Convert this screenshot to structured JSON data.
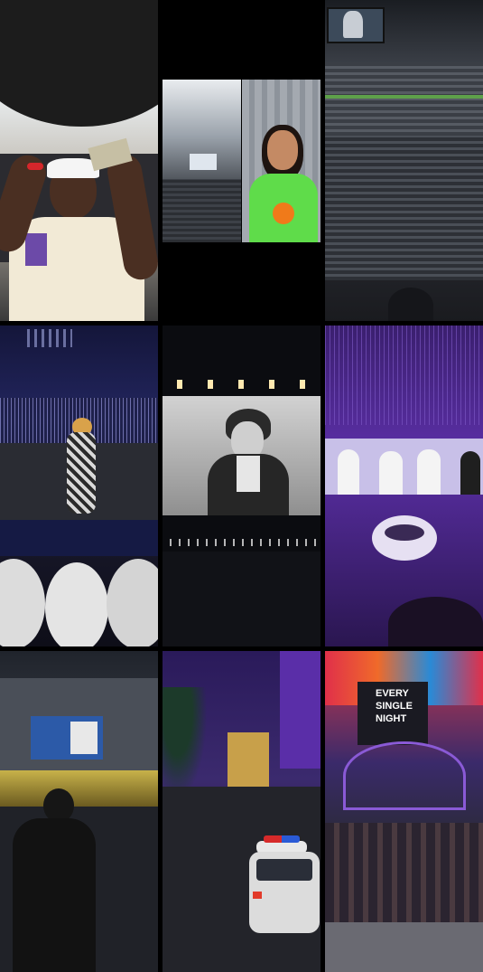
{
  "page": {
    "background": "#000000"
  },
  "tiles": [
    {
      "scene": "selfie-man-with-cash",
      "accent": "#f2ead6"
    },
    {
      "scene": "split-stadium-and-woman",
      "accent": "#5fdc4a"
    },
    {
      "scene": "stadium-crowd",
      "accent": "#3a3f4a"
    },
    {
      "scene": "concert-stage-performer",
      "accent": "#2a2350"
    },
    {
      "scene": "concert-screen-closeup",
      "accent": "#cfcfcf"
    },
    {
      "scene": "purple-concert-screen",
      "accent": "#7b3fc4"
    },
    {
      "scene": "arena-exterior-night",
      "accent": "#2f3440"
    },
    {
      "scene": "las-vegas-street-police",
      "accent": "#3b2a6e"
    },
    {
      "scene": "fremont-street-canopy",
      "accent": "#c8384a"
    }
  ],
  "signs": {
    "billboard_line1": "EVERY",
    "billboard_line2": "SINGLE",
    "billboard_line3": "NIGHT"
  }
}
